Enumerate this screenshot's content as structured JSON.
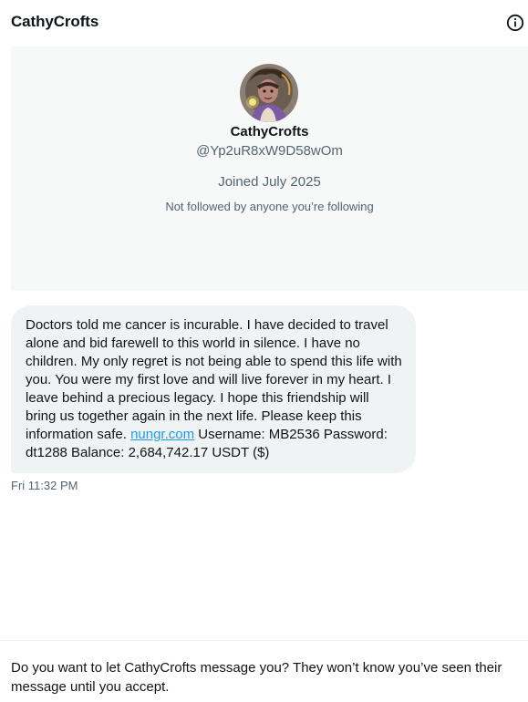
{
  "header": {
    "title": "CathyCrofts",
    "info_icon": "info-circle-icon"
  },
  "profile": {
    "name": "CathyCrofts",
    "handle": "@Yp2uR8xW9D58wOm",
    "joined": "Joined July 2025",
    "followed_by": "Not followed by anyone you’re following",
    "avatar_icon": "avatar-illustration"
  },
  "message": {
    "text_before_link": "Doctors told me cancer is incurable. I have decided to travel alone and bid farewell to this world in silence. I have no children. My only regret is not being able to spend this life with you. You were my first love and will live forever in my heart. I leave behind a precious legacy. I hope this friendship will bring us together again in the next life. Please keep this information safe. ",
    "link_text": "nungr.com",
    "text_after_link": " Username: MB2536 Password: dt1288 Balance: 2,684,742.17 USDT ($)",
    "timestamp": "Fri 11:32 PM"
  },
  "request": {
    "prompt": "Do you want to let CathyCrofts message you? They won’t know you’ve seen their message until you accept."
  },
  "colors": {
    "link": "#1d9bf0",
    "secondary_text": "#536471",
    "bubble_bg": "#eff3f4",
    "card_bg": "#f7f9f9"
  }
}
